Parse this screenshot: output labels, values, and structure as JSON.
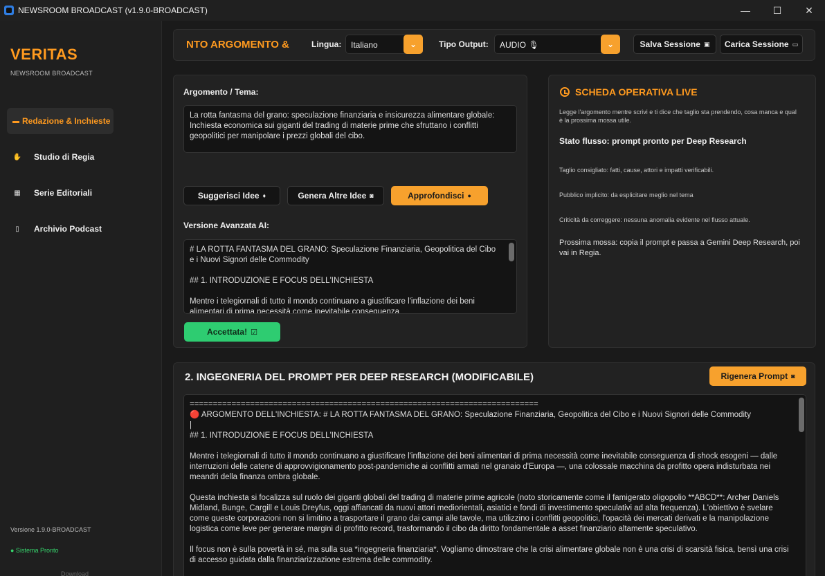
{
  "window": {
    "title": "NEWSROOM BROADCAST (v1.9.0-BROADCAST)",
    "minimize": "—",
    "maximize": "☐",
    "close": "✕"
  },
  "sidebar": {
    "brand": "VERITAS",
    "brand_sub": "NEWSROOM BROADCAST",
    "items": [
      {
        "label": "Redazione & Inchieste",
        "icon": "newspaper-icon",
        "glyph": "▬",
        "active": true
      },
      {
        "label": "Studio di Regia",
        "icon": "hand-icon",
        "glyph": "✋",
        "active": false
      },
      {
        "label": "Serie Editoriali",
        "icon": "calendar-icon",
        "glyph": "▦",
        "active": false
      },
      {
        "label": "Archivio Podcast",
        "icon": "phone-icon",
        "glyph": "▯",
        "active": false
      }
    ],
    "version": "Versione 1.9.0-BROADCAST",
    "status": "● Sistema Pronto",
    "ghost": "Download"
  },
  "topbar": {
    "marquee": "NTO ARGOMENTO & ",
    "language_label": "Lingua:",
    "language_value": "Italiano",
    "output_label": "Tipo Output:",
    "output_value": "AUDIO 🎙",
    "save_label": "Salva Sessione",
    "load_label": "Carica Sessione",
    "dropdown_glyph": "⌄"
  },
  "topic": {
    "label": "Argomento / Tema:",
    "text": "La rotta fantasma del grano: speculazione finanziaria e insicurezza alimentare globale: Inchiesta economica sui giganti del trading di materie prime che sfruttano i conflitti geopolitici per manipolare i prezzi globali del cibo.",
    "suggest_label": "Suggerisci Idee",
    "generate_label": "Genera Altre Idee",
    "deepen_label": "Approfondisci",
    "advanced_label": "Versione Avanzata AI:",
    "advanced_text": "# LA ROTTA FANTASMA DEL GRANO: Speculazione Finanziaria, Geopolitica del Cibo e i Nuovi Signori delle Commodity\n\n## 1. INTRODUZIONE E FOCUS DELL'INCHIESTA\n\nMentre i telegiornali di tutto il mondo continuano a giustificare l'inflazione dei beni alimentari di prima necessità come inevitabile conseguenza",
    "accept_label": "Accettata!"
  },
  "live": {
    "title": "SCHEDA OPERATIVA LIVE",
    "intro": "Legge l'argomento mentre scrivi e ti dice che taglio sta prendendo, cosa manca e qual è la prossima mossa utile.",
    "flow": "Stato flusso: prompt pronto per Deep Research",
    "cut": "Taglio consigliato: fatti, cause, attori e impatti verificabili.",
    "audience": "Pubblico implicito: da esplicitare meglio nel tema",
    "issues": "Criticità da correggere: nessuna anomalia evidente nel flusso attuale.",
    "next": "Prossima mossa: copia il prompt e passa a Gemini Deep Research, poi vai in Regia."
  },
  "prompt": {
    "title": "2. INGEGNERIA DEL PROMPT PER DEEP RESEARCH (MODIFICABILE)",
    "regen_label": "Rigenera Prompt",
    "text": "===========================================================================\n🔴 ARGOMENTO DELL'INCHIESTA: # LA ROTTA FANTASMA DEL GRANO: Speculazione Finanziaria, Geopolitica del Cibo e i Nuovi Signori delle Commodity\n|\n## 1. INTRODUZIONE E FOCUS DELL'INCHIESTA\n\nMentre i telegiornali di tutto il mondo continuano a giustificare l'inflazione dei beni alimentari di prima necessità come inevitabile conseguenza di shock esogeni — dalle interruzioni delle catene di approvvigionamento post-pandemiche ai conflitti armati nel granaio d'Europa —, una colossale macchina da profitto opera indisturbata nei meandri della finanza ombra globale.\n\nQuesta inchiesta si focalizza sul ruolo dei giganti globali del trading di materie prime agricole (noto storicamente come il famigerato oligopolio **ABCD**: Archer Daniels Midland, Bunge, Cargill e Louis Dreyfus, oggi affiancati da nuovi attori mediorientali, asiatici e fondi di investimento speculativi ad alta frequenza). L'obiettivo è svelare come queste corporazioni non si limitino a trasportare il grano dai campi alle tavole, ma utilizzino i conflitti geopolitici, l'opacità dei mercati derivati e la manipolazione logistica come leve per generare margini di profitto record, trasformando il cibo da diritto fondamentale a asset finanziario altamente speculativo.\n\nIl focus non è sulla povertà in sé, ma sulla sua *ingegneria finanziaria*. Vogliamo dimostrare che la crisi alimentare globale non è una crisi di scarsità fisica, bensì una crisi di accesso guidata dalla finanziarizzazione estrema delle commodity."
  },
  "colors": {
    "accent": "#ff9a1f",
    "button_orange": "#f7a12d",
    "success": "#2ecc71",
    "background": "#1a1a1a"
  }
}
